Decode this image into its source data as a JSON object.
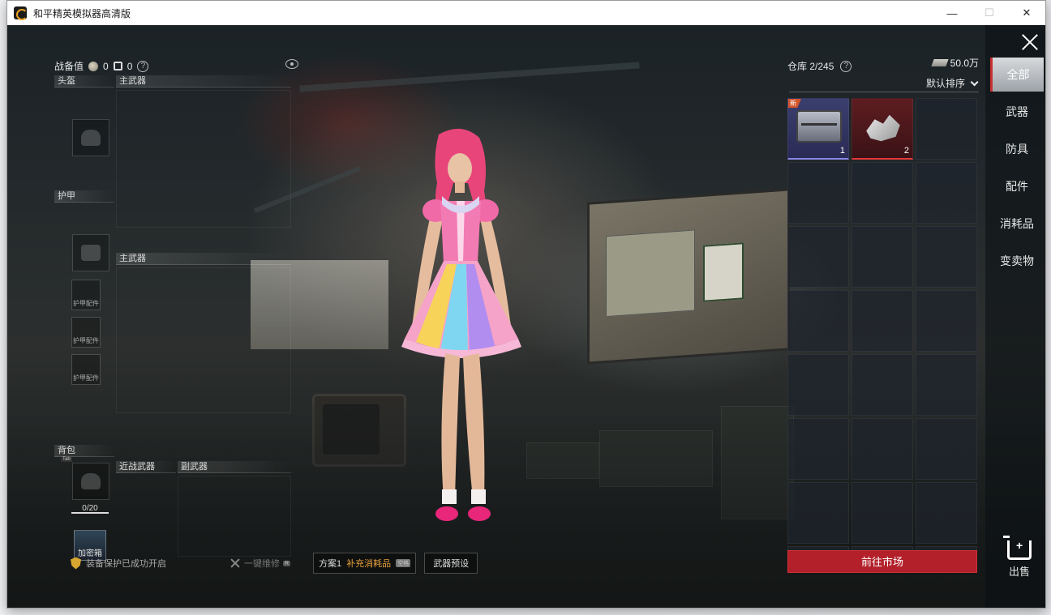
{
  "window": {
    "title": "和平精英模拟器高清版",
    "min": "—",
    "max": "☐",
    "close": "✕"
  },
  "left": {
    "combat_label": "战备值",
    "coin_value": "0",
    "lock_value": "0",
    "help": "?",
    "slots": {
      "helmet": "头盔",
      "primary1": "主武器",
      "armor": "护甲",
      "primary2": "主武器",
      "armor_acc": "护甲配件",
      "backpack": "背包",
      "melee": "近战武器",
      "secondary": "副武器"
    },
    "tab_key": "Tab",
    "bag_capacity": "0/20",
    "safe_box": "加密箱"
  },
  "bottom": {
    "protect": "装备保护已成功开启",
    "repair": "一键维修",
    "repair_key": "R",
    "plan": "方案1",
    "supply": "补充消耗品",
    "supply_key": "空格",
    "preset": "武器预设"
  },
  "warehouse": {
    "title": "仓库 2/245",
    "money": "50.0万",
    "sort": "默认排序",
    "items": [
      {
        "name": "chest",
        "qty": "1",
        "badge": "新",
        "rarity": "purple"
      },
      {
        "name": "shards",
        "qty": "2",
        "badge": "",
        "rarity": "red"
      }
    ],
    "market_button": "前往市场"
  },
  "categories": [
    "全部",
    "武器",
    "防具",
    "配件",
    "消耗品",
    "变卖物"
  ],
  "sell": "出售",
  "colors": {
    "accent_red": "#b3202a",
    "rarity_purple": "#8a87e8",
    "rarity_red": "#e23a3a",
    "orange": "#e8a23a"
  }
}
